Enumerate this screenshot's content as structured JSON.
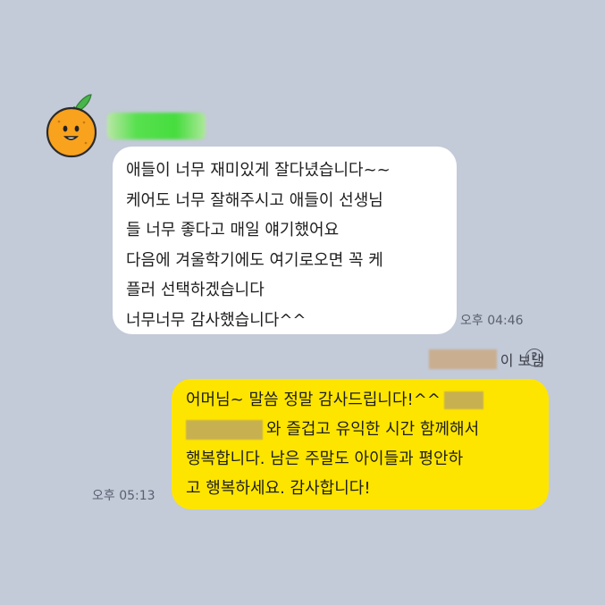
{
  "incoming": {
    "avatar_icon": "orange-character-icon",
    "lines": [
      "애들이 너무 재미있게 잘다녔습니다~~",
      "케어도 너무 잘해주시고 애들이 선생님",
      "들 너무 좋다고 매일 얘기했어요",
      "다음에 겨울학기에도 여기로오면 꼭 케",
      "플러 선택하겠습니다",
      "너무너무 감사했습니다^^"
    ],
    "time": "오후 04:46"
  },
  "sent_by": {
    "suffix": "이 보냄",
    "help_icon": "question-circle-icon"
  },
  "outgoing": {
    "line1": "어머님~ 말씀 정말 감사드립니다!^^",
    "line2": "와 즐겁고 유익한 시간 함께해서",
    "line3": "행복합니다. 남은 주말도 아이들과 평안하",
    "line4": "고 행복하세요. 감사합니다!",
    "time": "오후 05:13"
  },
  "colors": {
    "background": "#c3cad8",
    "incoming_bubble": "#ffffff",
    "outgoing_bubble": "#fee500"
  }
}
